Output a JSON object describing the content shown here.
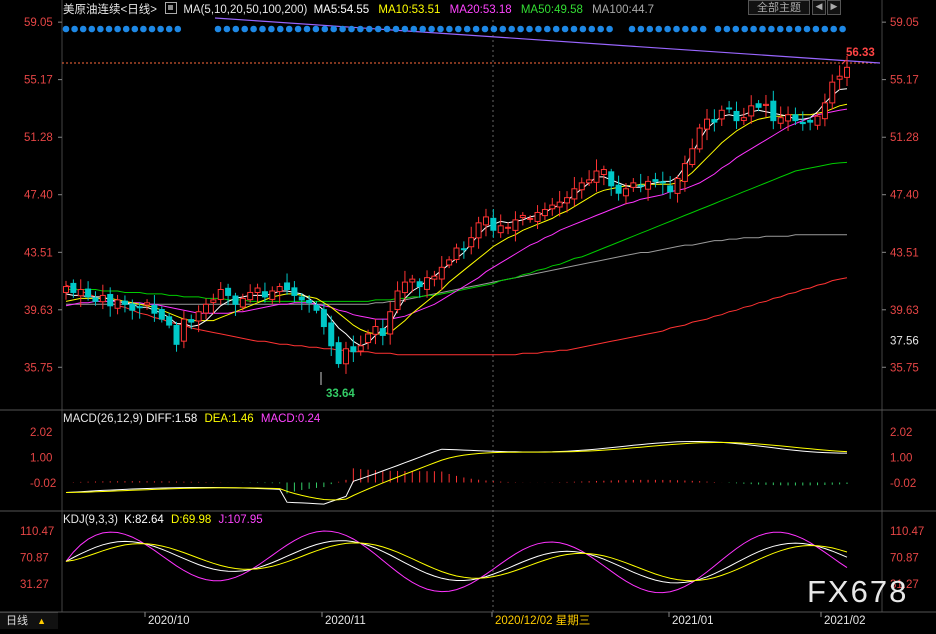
{
  "header": {
    "title": "美原油连续",
    "period": "<日线>",
    "ma_label": "MA(5,10,20,50,100,200)",
    "ma5": "MA5:54.55",
    "ma10": "MA10:53.51",
    "ma20": "MA20:53.18",
    "ma50": "MA50:49.58",
    "ma100": "MA100:44.7",
    "topic_button": "全部主题",
    "colors": {
      "ma5": "#ffffff",
      "ma10": "#ffff00",
      "ma20": "#ff33ff",
      "ma50": "#00cc00",
      "ma100": "#9a9a9a",
      "ma200": "#ff3333",
      "up": "#ff3333",
      "down": "#00c8c8"
    }
  },
  "macd": {
    "label": "MACD(26,12,9)",
    "diff": "DIFF:1.58",
    "dea": "DEA:1.46",
    "macd": "MACD:0.24",
    "ticks": [
      "2.02",
      "1.00",
      "-0.02"
    ]
  },
  "kdj": {
    "label": "KDJ(9,3,3)",
    "k": "K:82.64",
    "d": "D:69.98",
    "j": "J:107.95",
    "ticks": [
      "110.47",
      "70.87",
      "31.27"
    ]
  },
  "footer": {
    "period_button": "日线",
    "x_labels": [
      "2020/10",
      "2020/11",
      "2020/12/02 星期三",
      "2021/01",
      "2021/02"
    ]
  },
  "watermark": "FX678",
  "chart_data": {
    "type": "candlestick",
    "price_axis": [
      "59.05",
      "55.17",
      "51.28",
      "47.40",
      "43.51",
      "39.63",
      "35.75"
    ],
    "last_price_label": "37.56",
    "ylim": [
      33.0,
      59.6
    ],
    "high_annotation": "56.33",
    "low_annotation": "33.64",
    "candles_close": [
      41.2,
      40.8,
      41.0,
      40.5,
      40.2,
      40.6,
      39.9,
      40.3,
      40.0,
      39.6,
      39.8,
      40.1,
      39.4,
      39.0,
      38.6,
      37.3,
      39.0,
      38.8,
      39.5,
      40.0,
      40.3,
      41.0,
      40.6,
      40.0,
      40.4,
      40.8,
      41.1,
      40.5,
      40.9,
      41.2,
      41.0,
      40.6,
      40.3,
      40.1,
      39.6,
      38.5,
      37.2,
      36.0,
      37.0,
      36.8,
      37.2,
      38.0,
      38.5,
      37.9,
      39.5,
      40.9,
      41.5,
      41.7,
      41.2,
      41.8,
      41.9,
      42.5,
      43.0,
      43.8,
      43.7,
      44.5,
      45.5,
      45.9,
      45.0,
      45.3,
      45.2,
      45.7,
      46.0,
      45.8,
      46.2,
      46.4,
      46.7,
      46.9,
      47.2,
      47.8,
      48.2,
      48.4,
      49.0,
      49.1,
      48.0,
      47.5,
      47.8,
      48.2,
      48.0,
      48.3,
      48.3,
      48.2,
      47.6,
      48.5,
      49.5,
      50.5,
      51.9,
      52.5,
      52.3,
      53.1,
      53.2,
      52.4,
      52.6,
      53.4,
      53.3,
      53.5,
      52.4,
      52.6,
      52.8,
      52.4,
      52.2,
      52.3,
      52.7,
      53.6,
      55.0,
      55.4,
      56.0
    ],
    "ma5": [
      40.7,
      40.6,
      40.6,
      40.5,
      40.5,
      40.5,
      40.3,
      40.2,
      40.1,
      40.0,
      39.8,
      39.8,
      39.6,
      39.4,
      39.1,
      38.7,
      38.7,
      38.5,
      38.6,
      38.9,
      39.4,
      39.9,
      40.2,
      40.4,
      40.5,
      40.6,
      40.6,
      40.6,
      40.7,
      40.9,
      40.9,
      40.8,
      40.7,
      40.4,
      40.0,
      39.6,
      39.0,
      38.4,
      38.0,
      37.5,
      37.2,
      37.4,
      37.9,
      38.3,
      38.7,
      39.6,
      40.4,
      40.9,
      41.2,
      41.6,
      41.9,
      42.3,
      42.7,
      43.1,
      43.5,
      44.1,
      44.7,
      45.2,
      45.4,
      45.6,
      45.5,
      45.6,
      45.7,
      45.9,
      46.0,
      46.2,
      46.5,
      46.7,
      47.0,
      47.4,
      47.8,
      48.2,
      48.6,
      48.6,
      48.4,
      48.2,
      48.0,
      47.9,
      47.9,
      48.1,
      48.2,
      48.3,
      48.3,
      48.6,
      49.3,
      50.2,
      51.1,
      51.9,
      52.3,
      52.7,
      52.8,
      52.7,
      52.8,
      53.0,
      53.1,
      53.0,
      52.9,
      52.8,
      52.7,
      52.5,
      52.5,
      52.6,
      53.0,
      53.6,
      54.1,
      54.5,
      54.55
    ],
    "ma10": [
      40.2,
      40.3,
      40.4,
      40.4,
      40.4,
      40.4,
      40.4,
      40.3,
      40.2,
      40.1,
      40.0,
      39.9,
      39.8,
      39.6,
      39.4,
      39.2,
      39.0,
      38.9,
      38.9,
      38.9,
      38.9,
      39.1,
      39.3,
      39.5,
      39.7,
      39.9,
      40.1,
      40.3,
      40.5,
      40.6,
      40.7,
      40.7,
      40.6,
      40.5,
      40.4,
      40.1,
      39.8,
      39.4,
      39.0,
      38.6,
      38.3,
      38.1,
      38.0,
      38.0,
      38.1,
      38.5,
      38.9,
      39.4,
      39.8,
      40.2,
      40.6,
      41.0,
      41.5,
      41.9,
      42.3,
      42.7,
      43.1,
      43.5,
      43.9,
      44.2,
      44.5,
      44.7,
      45.0,
      45.2,
      45.4,
      45.6,
      45.8,
      46.1,
      46.3,
      46.6,
      46.9,
      47.2,
      47.5,
      47.7,
      47.8,
      47.9,
      48.0,
      48.0,
      48.1,
      48.1,
      48.1,
      48.1,
      48.1,
      48.2,
      48.5,
      48.9,
      49.4,
      49.9,
      50.4,
      50.9,
      51.3,
      51.7,
      52.0,
      52.3,
      52.5,
      52.6,
      52.7,
      52.7,
      52.8,
      52.8,
      52.8,
      52.8,
      52.9,
      53.0,
      53.2,
      53.4,
      53.51
    ],
    "ma20": [
      39.9,
      40.0,
      40.1,
      40.1,
      40.2,
      40.2,
      40.2,
      40.2,
      40.1,
      40.1,
      40.1,
      40.0,
      40.0,
      39.9,
      39.8,
      39.7,
      39.6,
      39.5,
      39.4,
      39.4,
      39.4,
      39.4,
      39.4,
      39.5,
      39.5,
      39.6,
      39.7,
      39.8,
      39.9,
      40.0,
      40.0,
      40.1,
      40.1,
      40.1,
      40.0,
      39.9,
      39.8,
      39.6,
      39.5,
      39.3,
      39.2,
      39.1,
      39.0,
      39.0,
      39.0,
      39.1,
      39.2,
      39.4,
      39.6,
      39.8,
      40.0,
      40.3,
      40.6,
      40.9,
      41.2,
      41.5,
      41.8,
      42.2,
      42.5,
      42.8,
      43.1,
      43.4,
      43.7,
      44.0,
      44.2,
      44.5,
      44.7,
      45.0,
      45.2,
      45.4,
      45.6,
      45.8,
      46.0,
      46.2,
      46.4,
      46.6,
      46.8,
      46.9,
      47.1,
      47.2,
      47.3,
      47.4,
      47.6,
      47.7,
      47.8,
      48.0,
      48.2,
      48.5,
      48.8,
      49.2,
      49.5,
      49.9,
      50.2,
      50.5,
      50.8,
      51.1,
      51.4,
      51.7,
      52.0,
      52.2,
      52.4,
      52.6,
      52.8,
      52.9,
      53.0,
      53.1,
      53.18
    ],
    "ma50": [
      41.0,
      41.0,
      41.0,
      41.0,
      41.0,
      40.9,
      40.9,
      40.9,
      40.8,
      40.8,
      40.8,
      40.7,
      40.7,
      40.7,
      40.6,
      40.6,
      40.5,
      40.5,
      40.5,
      40.4,
      40.4,
      40.4,
      40.3,
      40.3,
      40.3,
      40.2,
      40.2,
      40.2,
      40.2,
      40.2,
      40.2,
      40.2,
      40.2,
      40.2,
      40.2,
      40.2,
      40.2,
      40.2,
      40.2,
      40.2,
      40.2,
      40.2,
      40.3,
      40.3,
      40.3,
      40.4,
      40.4,
      40.5,
      40.5,
      40.6,
      40.6,
      40.7,
      40.8,
      40.9,
      41.0,
      41.1,
      41.2,
      41.3,
      41.4,
      41.6,
      41.7,
      41.8,
      42.0,
      42.1,
      42.3,
      42.4,
      42.6,
      42.7,
      42.9,
      43.1,
      43.2,
      43.4,
      43.6,
      43.8,
      44.0,
      44.2,
      44.4,
      44.6,
      44.8,
      45.0,
      45.2,
      45.4,
      45.6,
      45.8,
      46.0,
      46.2,
      46.4,
      46.6,
      46.8,
      47.0,
      47.2,
      47.4,
      47.6,
      47.8,
      48.0,
      48.2,
      48.4,
      48.6,
      48.8,
      49.0,
      49.1,
      49.2,
      49.3,
      49.4,
      49.5,
      49.55,
      49.58
    ],
    "ma100": [
      40.0,
      40.0,
      40.0,
      40.0,
      40.0,
      40.0,
      40.0,
      40.0,
      40.0,
      40.0,
      40.0,
      40.0,
      40.0,
      40.0,
      40.0,
      40.0,
      40.0,
      40.0,
      40.0,
      40.0,
      40.0,
      40.0,
      40.0,
      40.0,
      40.0,
      40.0,
      40.0,
      40.0,
      40.0,
      40.0,
      40.0,
      40.0,
      40.0,
      40.0,
      40.0,
      40.0,
      40.0,
      40.0,
      40.0,
      40.0,
      40.0,
      40.0,
      40.1,
      40.1,
      40.2,
      40.2,
      40.3,
      40.4,
      40.5,
      40.6,
      40.7,
      40.8,
      40.9,
      41.0,
      41.1,
      41.2,
      41.3,
      41.4,
      41.5,
      41.6,
      41.7,
      41.8,
      41.9,
      42.0,
      42.1,
      42.2,
      42.3,
      42.4,
      42.5,
      42.6,
      42.7,
      42.8,
      42.9,
      43.0,
      43.1,
      43.2,
      43.3,
      43.4,
      43.5,
      43.5,
      43.6,
      43.7,
      43.8,
      43.9,
      44.0,
      44.0,
      44.1,
      44.2,
      44.3,
      44.3,
      44.4,
      44.4,
      44.5,
      44.5,
      44.5,
      44.6,
      44.6,
      44.6,
      44.6,
      44.7,
      44.7,
      44.7,
      44.7,
      44.7,
      44.7,
      44.7,
      44.7
    ],
    "ma200": [
      41.3,
      41.1,
      40.9,
      40.7,
      40.5,
      40.3,
      40.1,
      39.9,
      39.8,
      39.6,
      39.4,
      39.3,
      39.1,
      39.0,
      38.8,
      38.7,
      38.6,
      38.4,
      38.3,
      38.2,
      38.1,
      38.0,
      37.9,
      37.8,
      37.7,
      37.6,
      37.5,
      37.5,
      37.4,
      37.3,
      37.3,
      37.2,
      37.2,
      37.1,
      37.1,
      37.0,
      37.0,
      36.9,
      36.9,
      36.8,
      36.8,
      36.8,
      36.7,
      36.7,
      36.7,
      36.6,
      36.6,
      36.6,
      36.6,
      36.6,
      36.6,
      36.6,
      36.6,
      36.6,
      36.6,
      36.6,
      36.6,
      36.6,
      36.6,
      36.6,
      36.6,
      36.6,
      36.7,
      36.7,
      36.7,
      36.8,
      36.8,
      36.9,
      36.9,
      37.0,
      37.1,
      37.2,
      37.3,
      37.4,
      37.5,
      37.6,
      37.7,
      37.8,
      37.9,
      38.0,
      38.1,
      38.2,
      38.4,
      38.5,
      38.6,
      38.8,
      38.9,
      39.0,
      39.2,
      39.3,
      39.5,
      39.6,
      39.8,
      39.9,
      40.1,
      40.2,
      40.4,
      40.5,
      40.7,
      40.8,
      41.0,
      41.1,
      41.3,
      41.4,
      41.6,
      41.7,
      41.8
    ]
  }
}
